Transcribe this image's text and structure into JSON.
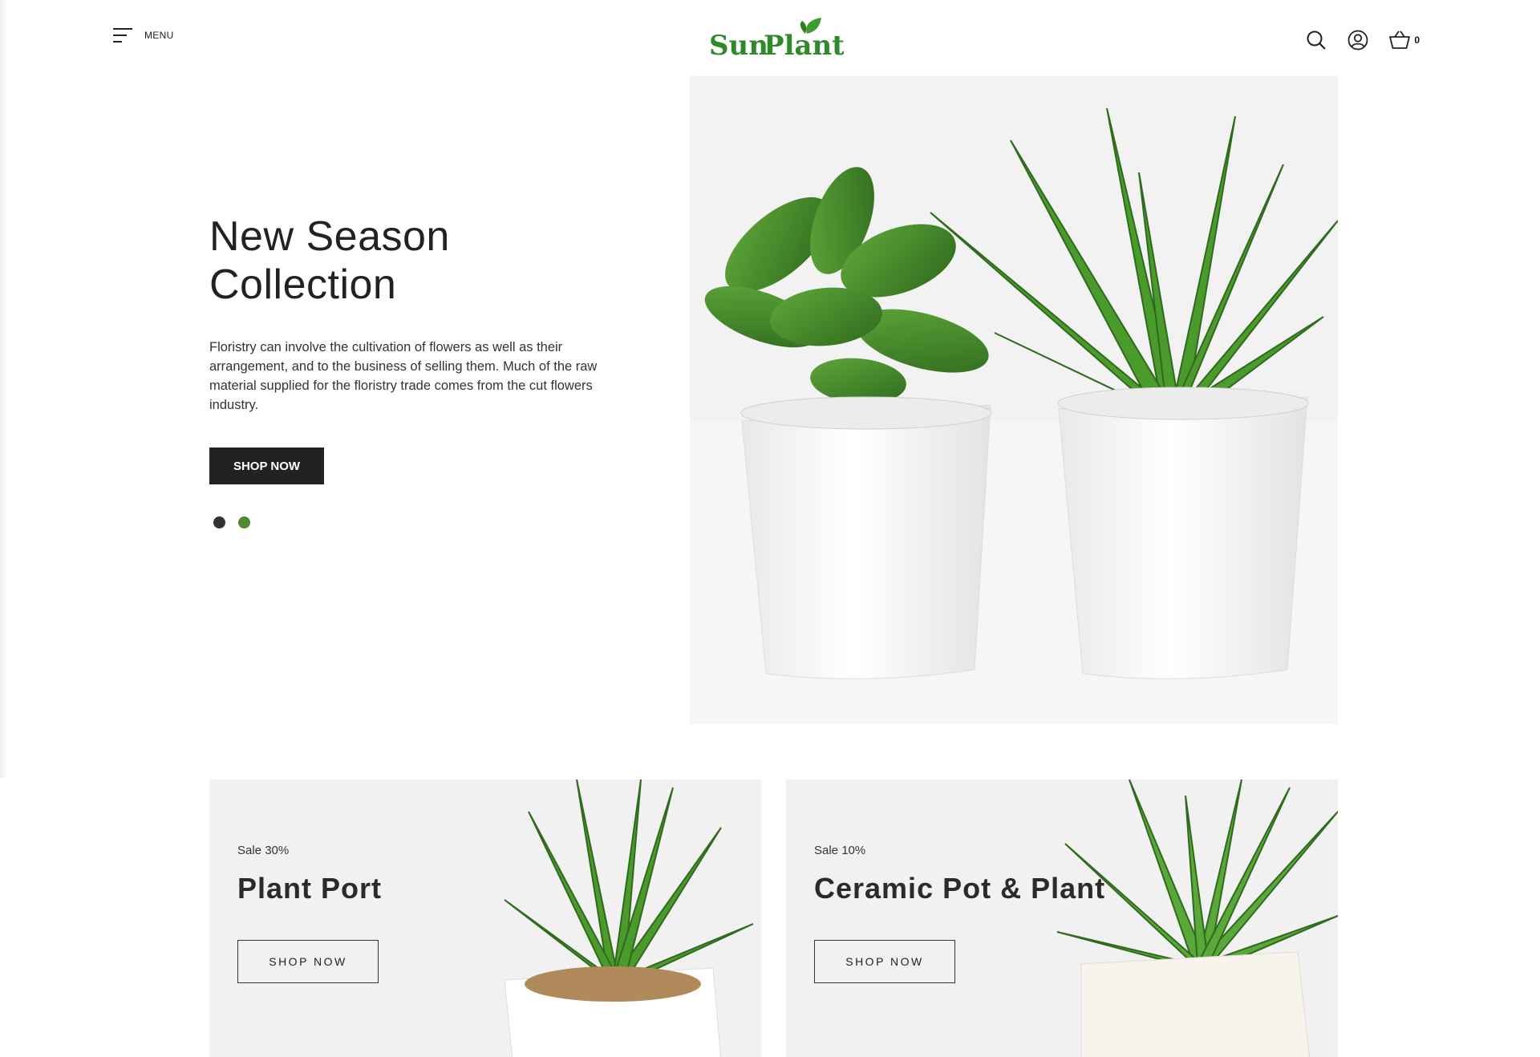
{
  "header": {
    "menu_label": "MENU",
    "logo_text_part1": "Sun",
    "logo_text_part2": "Plant",
    "cart_count": "0"
  },
  "hero": {
    "title_line1": "New Season",
    "title_line2": "Collection",
    "description": "Floristry can involve the cultivation of flowers as well as their arrangement, and to the business of selling them. Much of the raw material supplied for the floristry trade comes from the cut flowers industry.",
    "button_label": "SHOP NOW",
    "slides": 2,
    "active_slide": 2
  },
  "banners": [
    {
      "sale": "Sale 30%",
      "title": "Plant Port",
      "button_label": "SHOP NOW"
    },
    {
      "sale": "Sale 10%",
      "title": "Ceramic Pot & Plant",
      "button_label": "SHOP NOW"
    }
  ],
  "colors": {
    "brand_green": "#2f8a2a",
    "dark": "#222222",
    "dot_active": "#4e8a33",
    "dot_inactive": "#333333",
    "banner_bg": "#f1f1f1"
  },
  "icons": [
    "menu-icon",
    "search-icon",
    "user-icon",
    "cart-icon",
    "plant-leaf-icon"
  ]
}
